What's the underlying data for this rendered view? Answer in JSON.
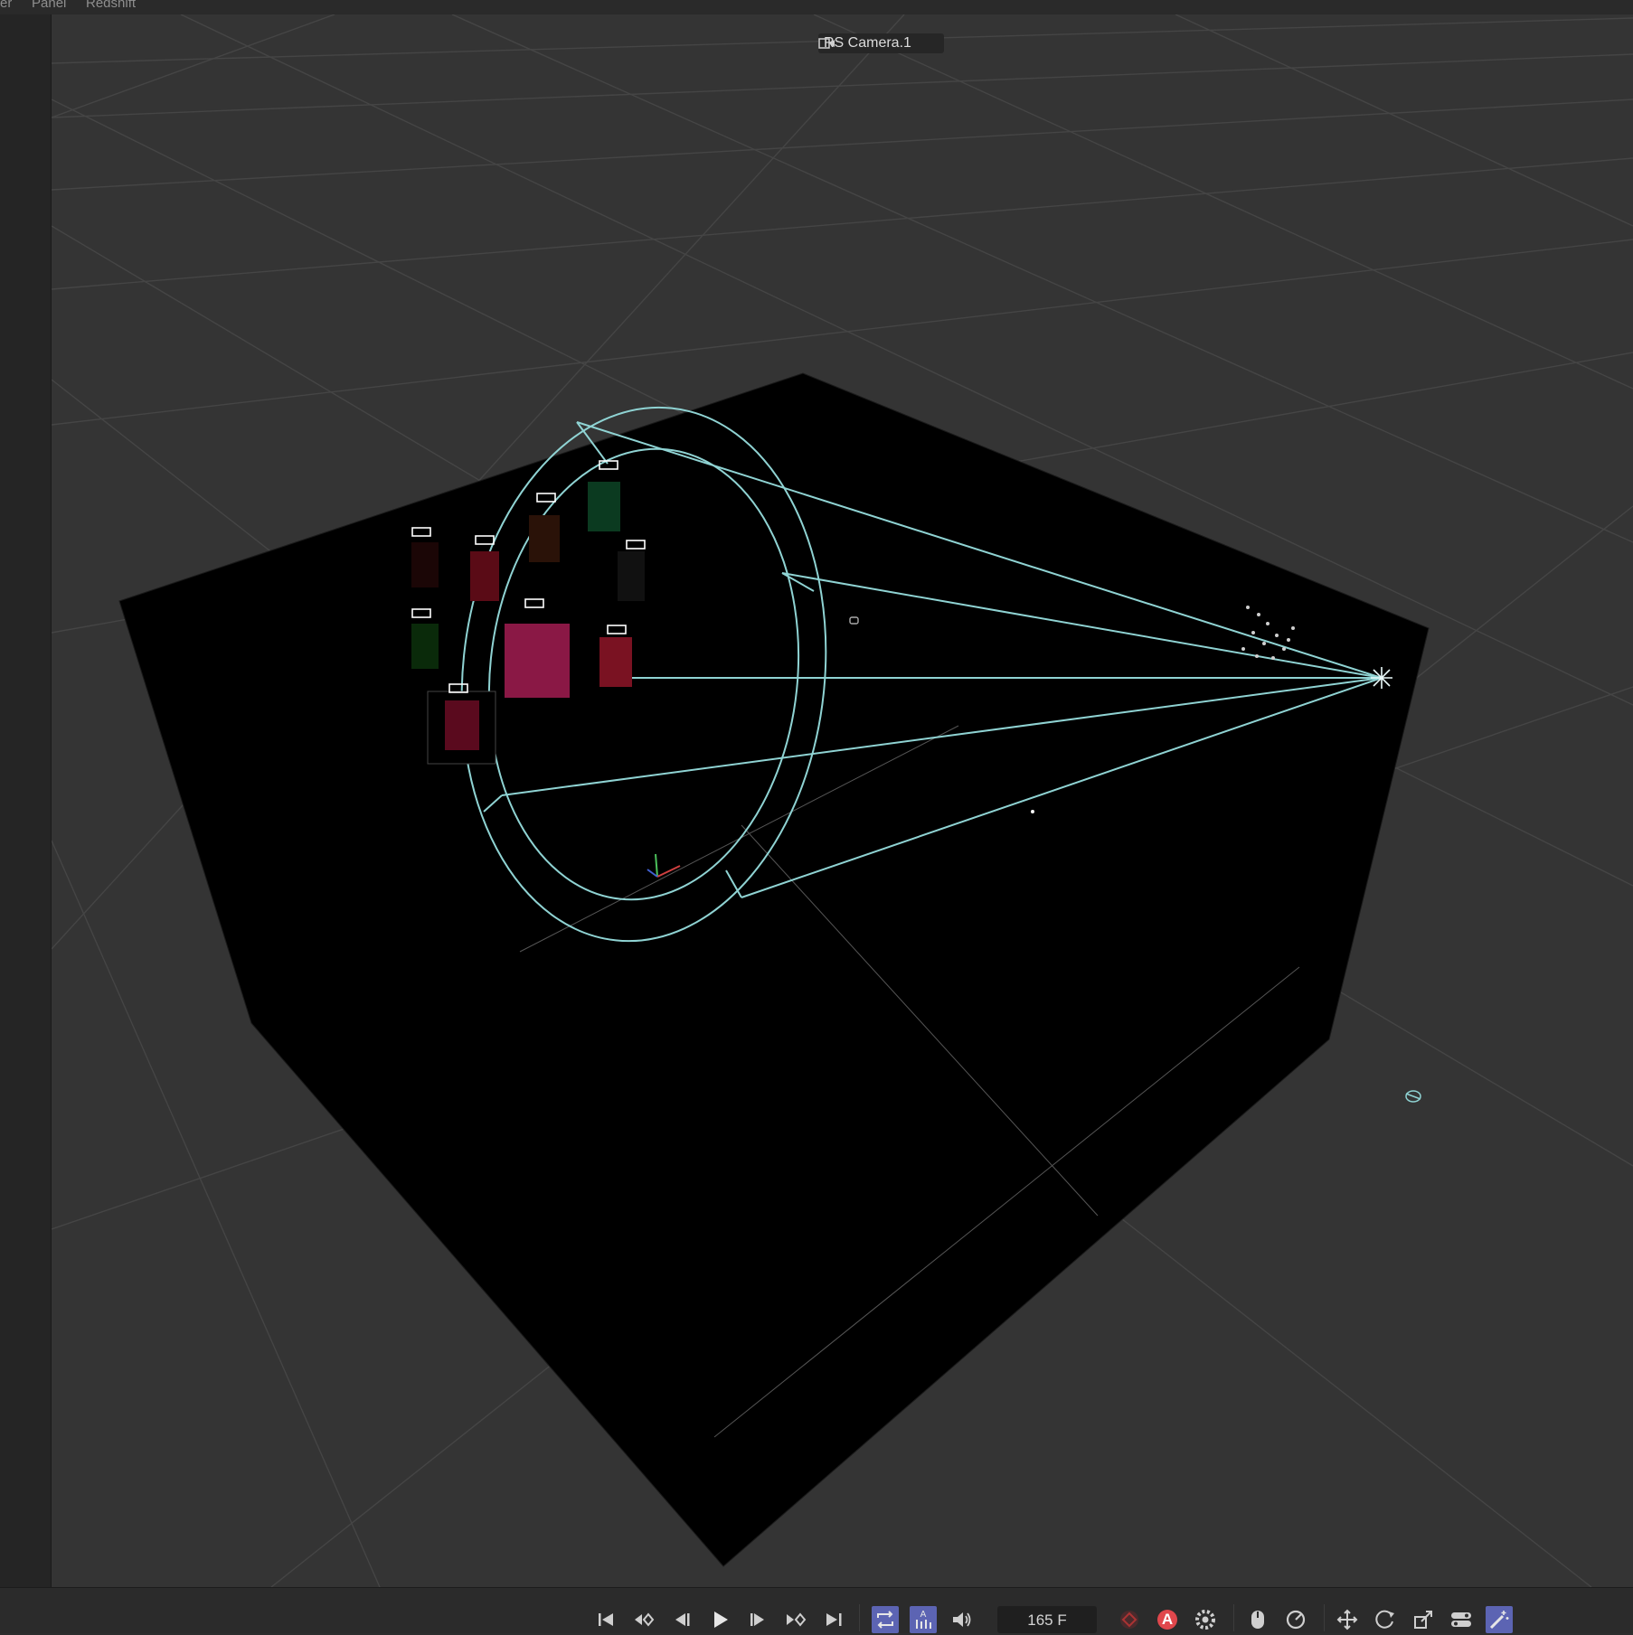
{
  "menu": {
    "items": [
      "er",
      "Panel",
      "Redshift"
    ]
  },
  "viewport": {
    "camera_name": "RS Camera.1",
    "icons": [
      "camera-link-icon"
    ]
  },
  "timeline": {
    "frame": "165 F",
    "auto_key_label": "A",
    "buttons": [
      "go-to-start",
      "previous-key",
      "previous-frame",
      "play",
      "next-frame",
      "next-key",
      "go-to-end",
      "loop",
      "auto-keying",
      "sound",
      "record",
      "auto-key",
      "settings",
      "mouse",
      "scale",
      "move-keys",
      "rotate-keys",
      "scale-keys",
      "toggle",
      "magic-tool"
    ]
  },
  "colors": {
    "viewport_bg": "#343434",
    "camera_wire": "#8fd3d3",
    "accent": "#5c64b3",
    "record_red": "#e0474c"
  }
}
